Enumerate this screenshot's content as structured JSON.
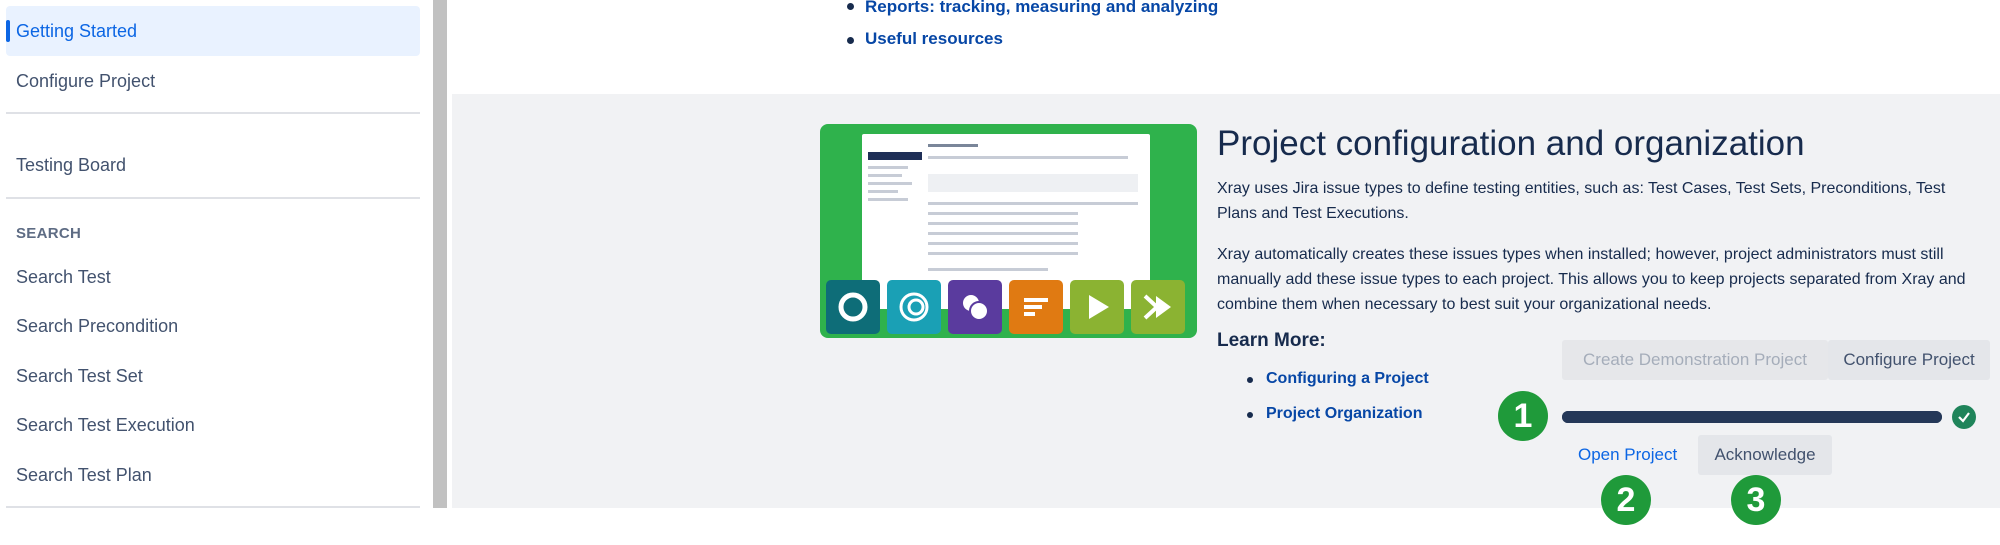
{
  "sidebar": {
    "items": [
      {
        "label": "Getting Started",
        "active": true
      },
      {
        "label": "Configure Project"
      },
      {
        "label": "Testing Board"
      }
    ],
    "search_section": {
      "label": "SEARCH",
      "items": [
        {
          "label": "Search Test"
        },
        {
          "label": "Search Precondition"
        },
        {
          "label": "Search Test Set"
        },
        {
          "label": "Search Test Execution"
        },
        {
          "label": "Search Test Plan"
        }
      ]
    }
  },
  "top_list": [
    {
      "label": "Reports: tracking, measuring and analyzing"
    },
    {
      "label": "Useful resources"
    }
  ],
  "card": {
    "thumbnail": {
      "icons": [
        "test-icon",
        "precondition-icon",
        "test-set-icon",
        "test-plan-icon",
        "test-execution-icon",
        "test-run-icon"
      ],
      "icon_colors": [
        "#0e6d78",
        "#1aa0b5",
        "#5a3b9e",
        "#e07a12",
        "#8bb332",
        "#8bb332"
      ]
    },
    "title": "Project configuration and organization",
    "paragraphs": [
      "Xray uses Jira issue types to define testing entities, such as: Test Cases, Test Sets, Preconditions, Test Plans and Test Executions.",
      "Xray automatically creates these issues types when installed; however, project administrators must still manually add these issue types to each project. This allows you to keep projects separated from Xray and combine them when necessary to best suit your organizational needs."
    ],
    "learn_more": {
      "label": "Learn More:",
      "links": [
        {
          "label": "Configuring a Project"
        },
        {
          "label": "Project Organization"
        }
      ]
    },
    "actions": {
      "create_demo_label": "Create Demonstration Project",
      "configure_label": "Configure Project",
      "open_project_label": "Open Project",
      "acknowledge_label": "Acknowledge"
    },
    "progress": {
      "value": 1.0,
      "complete": true
    }
  },
  "callouts": [
    "1",
    "2",
    "3"
  ],
  "colors": {
    "accent": "#0c66e4",
    "link": "#0747a6",
    "thumbnail_bg": "#2fb24c",
    "callout": "#1f9a3a",
    "panel_bg": "#f1f2f4"
  }
}
